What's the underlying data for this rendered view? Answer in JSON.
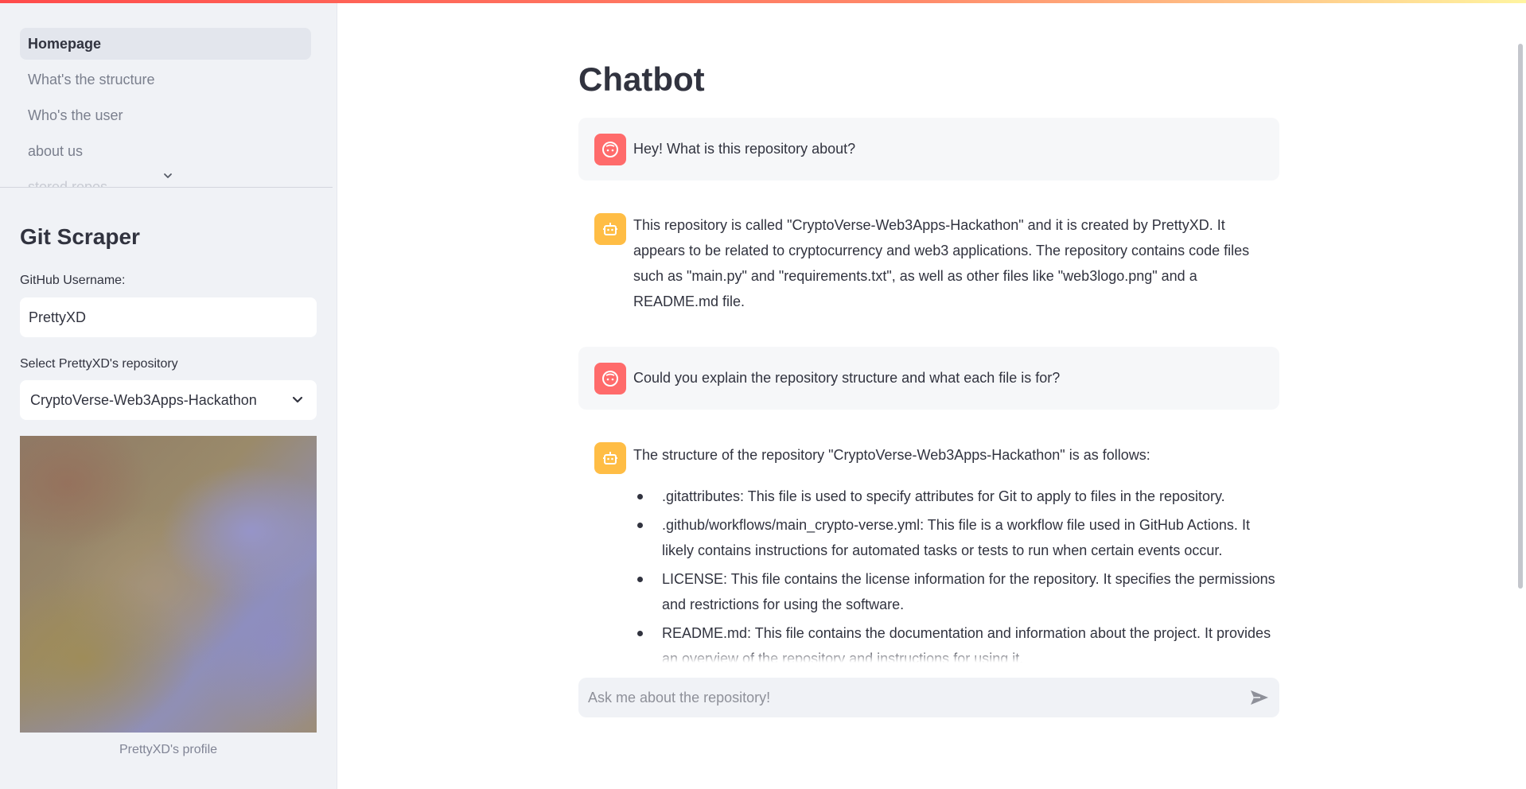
{
  "sidebar": {
    "nav": [
      {
        "label": "Homepage"
      },
      {
        "label": "What's the structure"
      },
      {
        "label": "Who's the user"
      },
      {
        "label": "about us"
      },
      {
        "label": "stored repos"
      }
    ],
    "title": "Git Scraper",
    "username_label": "GitHub Username:",
    "username_value": "PrettyXD",
    "repo_label": "Select PrettyXD's repository",
    "repo_selected": "CryptoVerse-Web3Apps-Hackathon",
    "avatar_caption": "PrettyXD's profile"
  },
  "main": {
    "title": "Chatbot",
    "messages": [
      {
        "role": "user",
        "text": "Hey! What is this repository about?"
      },
      {
        "role": "assistant",
        "text": "This repository is called \"CryptoVerse-Web3Apps-Hackathon\" and it is created by PrettyXD. It appears to be related to cryptocurrency and web3 applications. The repository contains code files such as \"main.py\" and \"requirements.txt\", as well as other files like \"web3logo.png\" and a README.md file."
      },
      {
        "role": "user",
        "text": "Could you explain the repository structure and what each file is for?"
      },
      {
        "role": "assistant",
        "text": "The structure of the repository \"CryptoVerse-Web3Apps-Hackathon\" is as follows:",
        "bullets": [
          ".gitattributes: This file is used to specify attributes for Git to apply to files in the repository.",
          ".github/workflows/main_crypto-verse.yml: This file is a workflow file used in GitHub Actions. It likely contains instructions for automated tasks or tests to run when certain events occur.",
          "LICENSE: This file contains the license information for the repository. It specifies the permissions and restrictions for using the software.",
          "README.md: This file contains the documentation and information about the project. It provides an overview of the repository and instructions for using it."
        ]
      }
    ],
    "chat_input_placeholder": "Ask me about the repository!"
  },
  "colors": {
    "accent_red": "#ff6b6b",
    "accent_yellow": "#ffbd45",
    "sidebar_bg": "#f0f2f6"
  }
}
